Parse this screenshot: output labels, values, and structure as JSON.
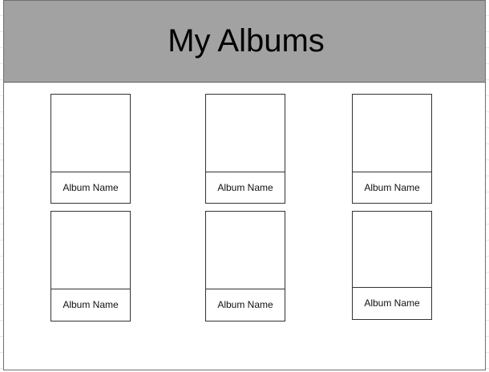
{
  "header": {
    "title": "My Albums"
  },
  "albums": [
    {
      "name": "Album Name"
    },
    {
      "name": "Album Name"
    },
    {
      "name": "Album Name"
    },
    {
      "name": "Album Name"
    },
    {
      "name": "Album Name"
    },
    {
      "name": "Album Name"
    }
  ],
  "colors": {
    "header_bg": "#a2a2a2",
    "border": "#333333"
  }
}
